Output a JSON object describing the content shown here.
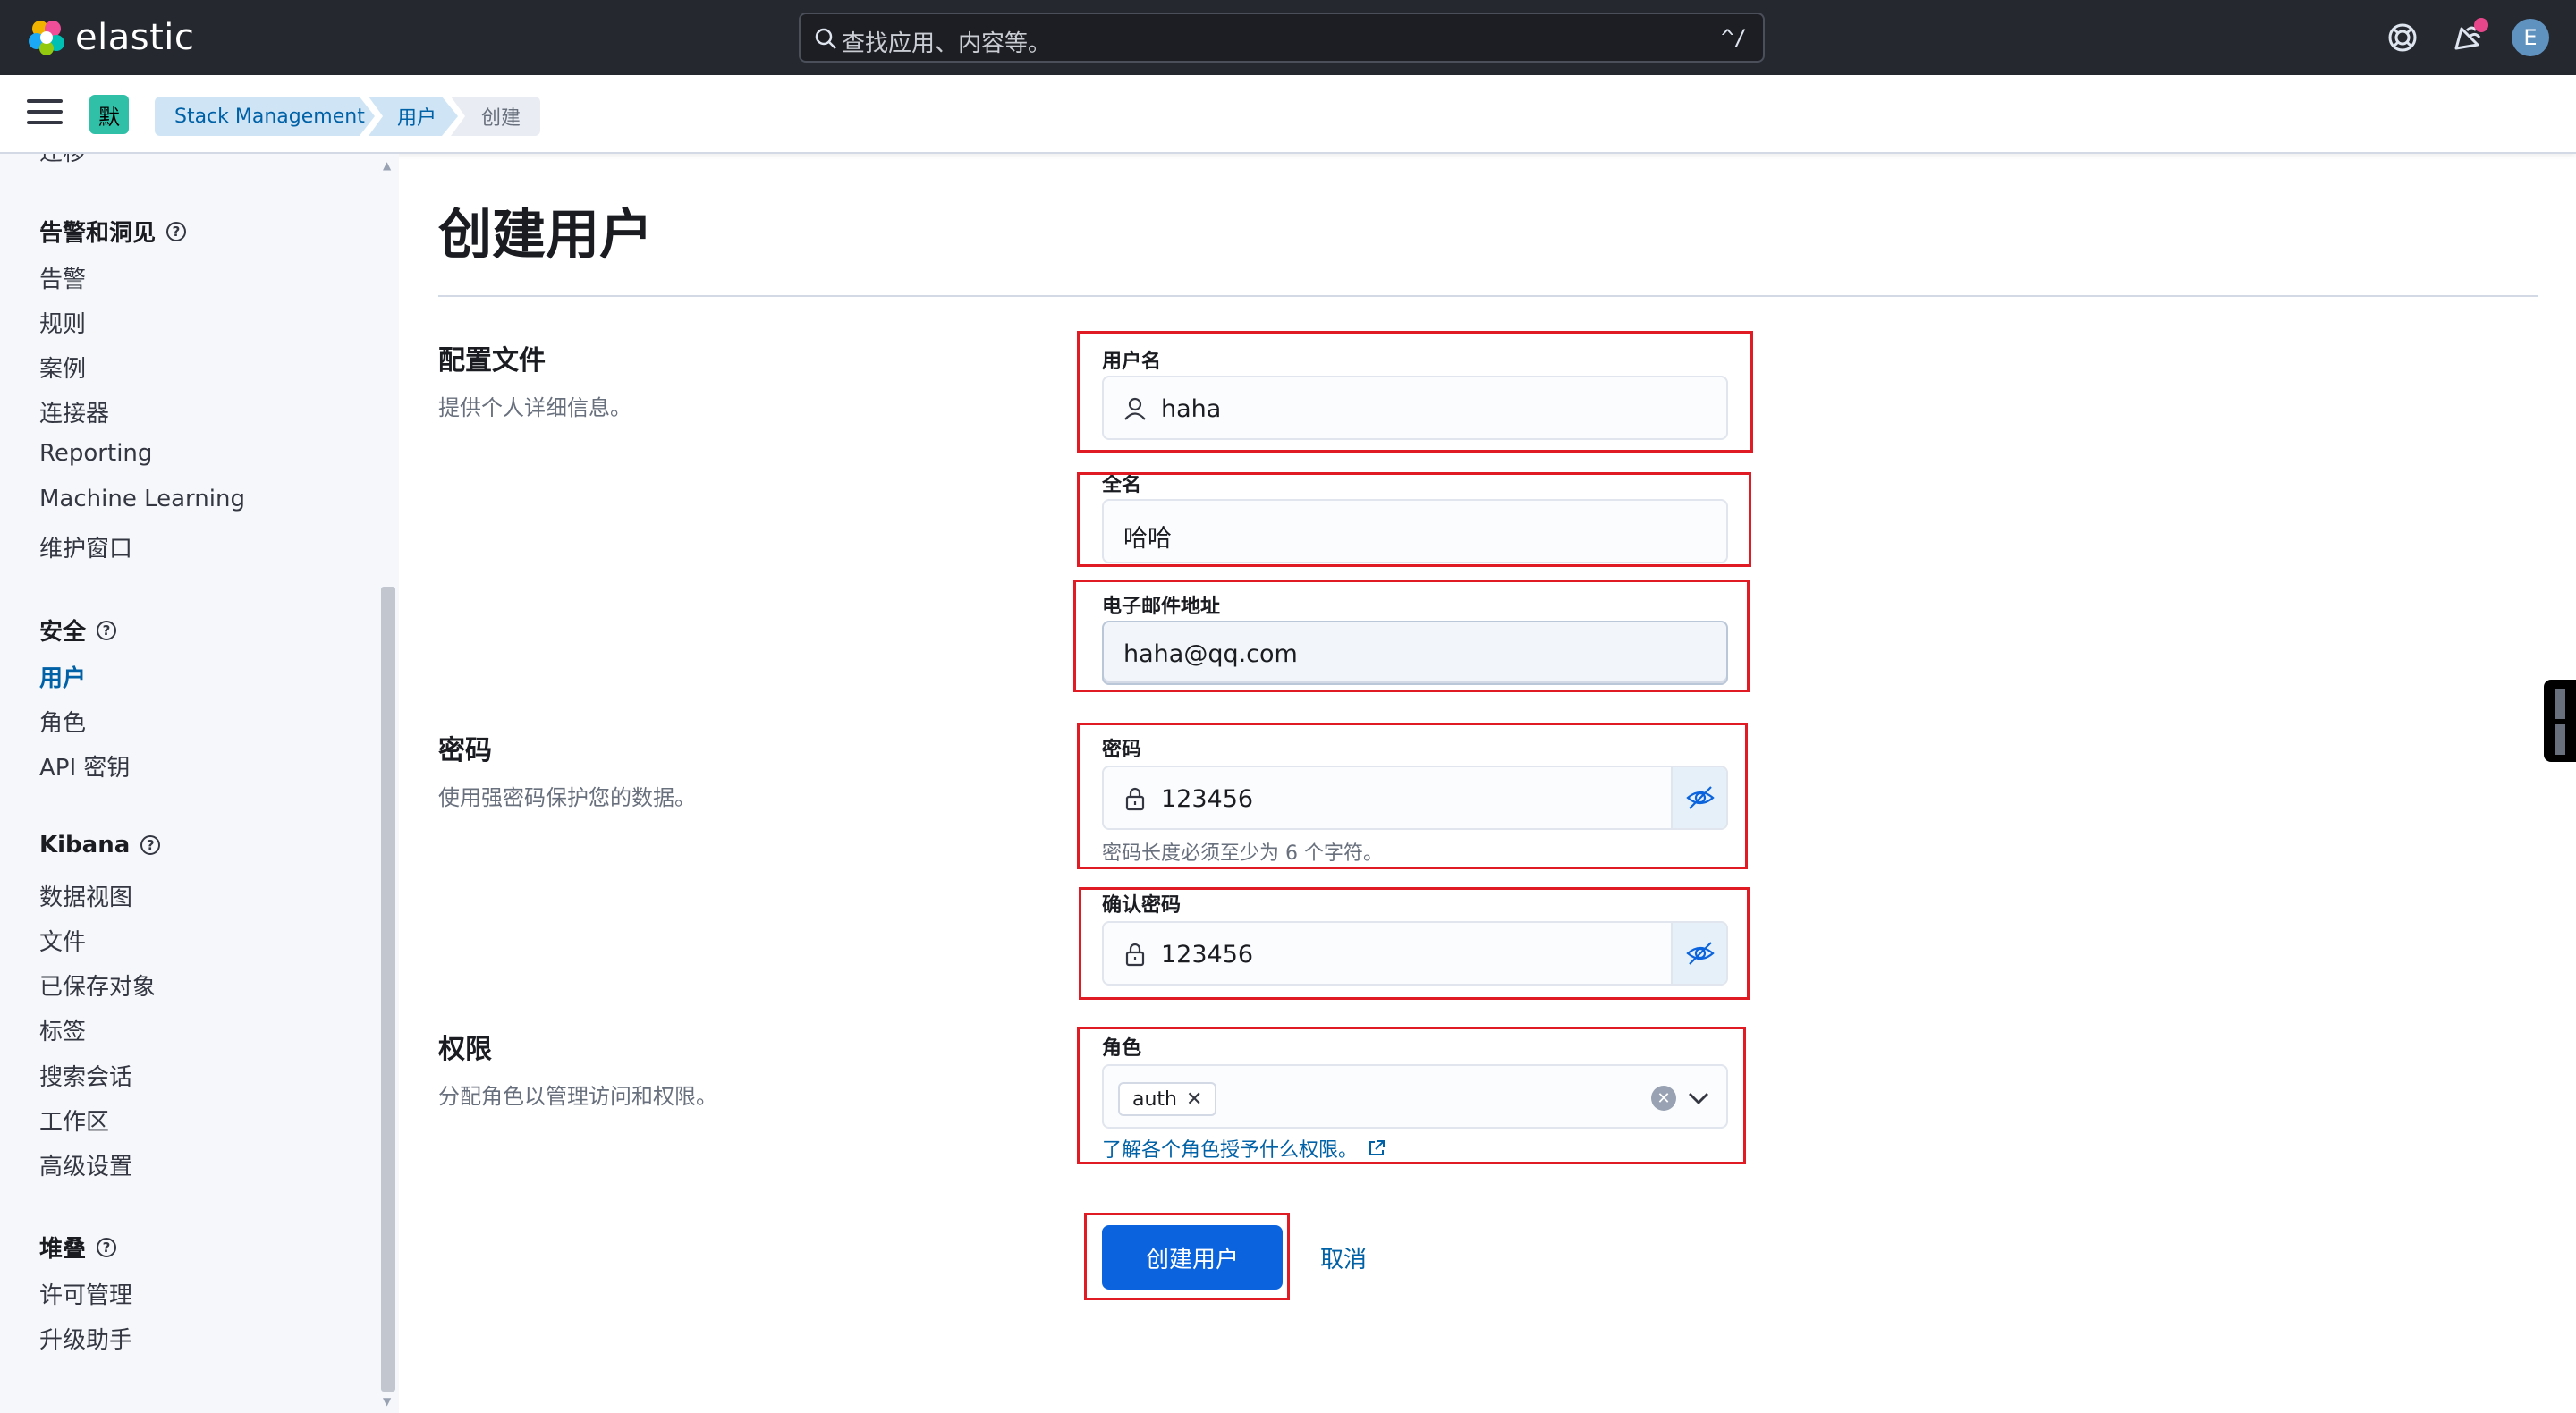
{
  "app": {
    "brand": "elastic",
    "search_placeholder": "查找应用、内容等。",
    "search_shortcut": "^/",
    "avatar_initial": "E",
    "space_badge": "默"
  },
  "breadcrumbs": [
    "Stack Management",
    "用户",
    "创建"
  ],
  "sidebar": {
    "cut_item": "迁移",
    "groups": [
      {
        "title": "告警和洞见",
        "items": [
          "告警",
          "规则",
          "案例",
          "连接器",
          "Reporting",
          "Machine Learning",
          "维护窗口"
        ]
      },
      {
        "title": "安全",
        "items": [
          "用户",
          "角色",
          "API 密钥"
        ],
        "active_item": "用户"
      },
      {
        "title": "Kibana",
        "items": [
          "数据视图",
          "文件",
          "已保存对象",
          "标签",
          "搜索会话",
          "工作区",
          "高级设置"
        ]
      },
      {
        "title": "堆叠",
        "items": [
          "许可管理",
          "升级助手"
        ]
      }
    ]
  },
  "page": {
    "title": "创建用户",
    "sections": {
      "profile": {
        "title": "配置文件",
        "desc": "提供个人详细信息。"
      },
      "password": {
        "title": "密码",
        "desc": "使用强密码保护您的数据。"
      },
      "privileges": {
        "title": "权限",
        "desc": "分配角色以管理访问和权限。"
      }
    },
    "fields": {
      "username": {
        "label": "用户名",
        "value": "haha"
      },
      "fullname": {
        "label": "全名",
        "value": "哈哈"
      },
      "email": {
        "label": "电子邮件地址",
        "value": "haha@qq.com"
      },
      "password": {
        "label": "密码",
        "value": "123456",
        "help": "密码长度必须至少为 6 个字符。"
      },
      "confirm_password": {
        "label": "确认密码",
        "value": "123456"
      },
      "roles": {
        "label": "角色",
        "selected": "auth",
        "link": "了解各个角色授予什么权限。"
      }
    },
    "actions": {
      "submit": "创建用户",
      "cancel": "取消"
    }
  },
  "colors": {
    "accent": "#0b64dd",
    "link": "#0061a6",
    "highlight_box": "#e01b24",
    "header_bg": "#25282f"
  }
}
